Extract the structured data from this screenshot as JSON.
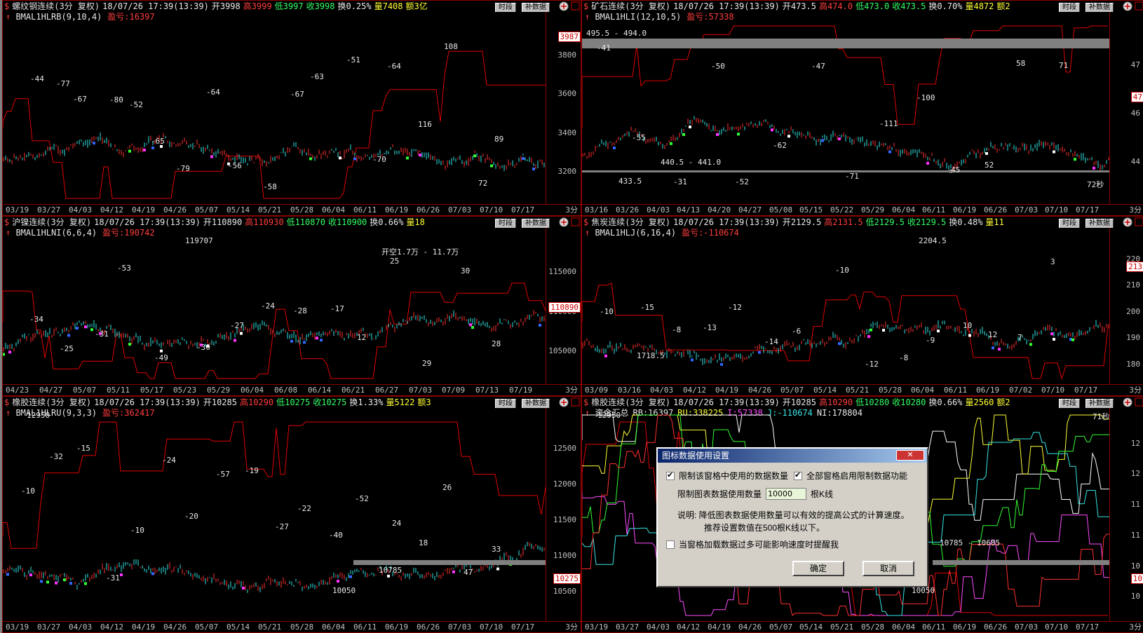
{
  "panels": [
    {
      "id": "rb",
      "title": "螺纹钢连续(3分 复权)",
      "datetime": "18/07/26 17:39(13:39)",
      "quote": {
        "open": "开3998",
        "high": "高3999",
        "low": "低3997",
        "close": "收3998",
        "turnover": "换0.25%",
        "volume": "量7408",
        "amount": "额3亿"
      },
      "btn1": "时段",
      "btn2": "补数据",
      "indicator": "BMAL1HLRB(9,10,4)",
      "pnl": "盈亏:16397",
      "y_ticks": [
        "3800",
        "3600",
        "3400",
        "3200"
      ],
      "price_tag": "3987",
      "x_ticks": [
        "03/19",
        "03/27",
        "04/03",
        "04/12",
        "04/19",
        "04/26",
        "05/07",
        "05/14",
        "05/21",
        "05/28",
        "06/04",
        "06/11",
        "06/19",
        "06/26",
        "07/03",
        "07/10",
        "07/17"
      ],
      "period": "3分",
      "notes": [
        "-44",
        "-77",
        "-67",
        "-80",
        "-52",
        "-65",
        "-79",
        "-64",
        "-56",
        "-58",
        "-67",
        "-63",
        "-51",
        "-70",
        "-64",
        "116",
        "108",
        "72",
        "89"
      ]
    },
    {
      "id": "i",
      "title": "矿石连续(3分 复权)",
      "datetime": "18/07/26 17:39(13:39)",
      "quote": {
        "open": "开473.5",
        "high": "高474.0",
        "low": "低473.0",
        "close": "收473.5",
        "turnover": "换0.70%",
        "volume": "量4872",
        "amount": "额2"
      },
      "btn1": "时段",
      "btn2": "补数据",
      "indicator": "BMAL1HLI(12,10,5)",
      "pnl": "盈亏:57338",
      "y_ticks": [
        "47",
        "46",
        "44"
      ],
      "price_tag": "47",
      "x_ticks": [
        "03/16",
        "03/26",
        "04/03",
        "04/13",
        "04/20",
        "04/27",
        "05/08",
        "05/15",
        "05/22",
        "05/29",
        "06/04",
        "06/11",
        "06/19",
        "06/26",
        "07/03",
        "07/10",
        "07/17"
      ],
      "period": "3分",
      "annot": [
        "495.5 - 494.0",
        "440.5 - 441.0",
        "433.5",
        "72秒"
      ],
      "notes": [
        "-41",
        "-55",
        "-31",
        "-50",
        "-52",
        "-62",
        "-47",
        "-71",
        "-111",
        "-100",
        "45",
        "52",
        "58",
        "71"
      ]
    },
    {
      "id": "ni",
      "title": "沪镍连续(3分 复权)",
      "datetime": "18/07/26 17:39(13:39)",
      "quote": {
        "open": "开110890",
        "high": "高110930",
        "low": "低110870",
        "close": "收110900",
        "turnover": "换0.66%",
        "volume": "量18"
      },
      "btn1": "时段",
      "btn2": "补数据",
      "indicator": "BMAL1HLNI(6,6,4)",
      "pnl": "盈亏:190742",
      "y_ticks": [
        "115000",
        "110000",
        "105000"
      ],
      "price_tag": "110890",
      "x_ticks": [
        "04/23",
        "04/27",
        "05/07",
        "05/11",
        "05/17",
        "05/23",
        "05/29",
        "06/04",
        "06/08",
        "06/14",
        "06/21",
        "06/27",
        "07/03",
        "07/09",
        "07/13",
        "07/19"
      ],
      "period": "3分",
      "annot": [
        "119707",
        "开空1.7万 - 11.7万"
      ],
      "notes": [
        "-34",
        "-25",
        "-31",
        "-53",
        "-49",
        "-30",
        "-27",
        "-24",
        "-28",
        "-17",
        "12",
        "25",
        "29",
        "30",
        "28"
      ]
    },
    {
      "id": "j",
      "title": "焦炭连续(3分 复权)",
      "datetime": "18/07/26 17:39(13:39)",
      "quote": {
        "open": "开2129.5",
        "high": "高2131.5",
        "low": "低2129.5",
        "close": "收2129.5",
        "turnover": "换0.48%",
        "volume": "量11"
      },
      "btn1": "时段",
      "btn2": "补数据",
      "indicator": "BMAL1HLJ(6,16,4)",
      "pnl": "盈亏:-110674",
      "y_ticks": [
        "220",
        "210",
        "200",
        "190",
        "180"
      ],
      "price_tag": "213",
      "x_ticks": [
        "03/09",
        "03/16",
        "04/03",
        "04/12",
        "04/19",
        "04/26",
        "05/07",
        "05/14",
        "05/21",
        "05/28",
        "06/04",
        "06/11",
        "06/19",
        "07/02",
        "07/10",
        "07/17"
      ],
      "period": "3分",
      "annot": [
        "2204.5",
        "1718.5"
      ],
      "notes": [
        "-10",
        "-15",
        "-8",
        "-13",
        "-12",
        "-14",
        "-6",
        "-10",
        "-12",
        "-8",
        "-9",
        "10",
        "12",
        "7",
        "3"
      ]
    },
    {
      "id": "ru",
      "title": "橡胶连续(3分 复权)",
      "datetime": "18/07/26 17:39(13:39)",
      "quote": {
        "open": "开10285",
        "high": "高10290",
        "low": "低10275",
        "close": "收10275",
        "turnover": "换1.33%",
        "volume": "量5122",
        "amount": "额3"
      },
      "btn1": "时段",
      "btn2": "补数据",
      "indicator": "BMAL1HLRU(9,3,3)",
      "pnl": "盈亏:362417",
      "y_ticks": [
        "12500",
        "12000",
        "11500",
        "11000",
        "10500"
      ],
      "price_tag": "10275",
      "x_ticks": [
        "03/19",
        "03/27",
        "04/03",
        "04/12",
        "04/19",
        "04/26",
        "05/07",
        "05/14",
        "05/21",
        "05/28",
        "06/04",
        "06/11",
        "06/19",
        "06/26",
        "07/03",
        "07/10",
        "07/17"
      ],
      "period": "3分",
      "annot": [
        "12950",
        "10785",
        "10050"
      ],
      "notes": [
        "-10",
        "-32",
        "-15",
        "-31",
        "-10",
        "-24",
        "-20",
        "-57",
        "-19",
        "-27",
        "-22",
        "-40",
        "-52",
        "24",
        "18",
        "26",
        "47",
        "33"
      ]
    },
    {
      "id": "sum",
      "title": "橡胶连续(3分 复权)",
      "datetime": "18/07/26 17:39(13:39)",
      "quote": {
        "open": "开10285",
        "high": "高10290",
        "low": "低10280",
        "close": "收10280",
        "turnover": "换0.66%",
        "volume": "量2560",
        "amount": "额2"
      },
      "btn1": "时段",
      "btn2": "补数据",
      "legend": {
        "label": "资金汇总",
        "rb": "RB:16397",
        "ru": "RU:338225",
        "i": "I:57338",
        "j": "J:-110674",
        "ni": "NI:178804"
      },
      "y_ticks": [
        "12",
        "12",
        "11",
        "11",
        "10",
        "10"
      ],
      "price_tag": "10",
      "x_ticks": [
        "03/19",
        "03/27",
        "04/03",
        "04/12",
        "04/19",
        "04/26",
        "05/07",
        "05/14",
        "05/21",
        "05/28",
        "06/04",
        "06/11",
        "06/19",
        "06/26",
        "07/03",
        "07/10",
        "07/17"
      ],
      "period": "3分",
      "annot": [
        "12950",
        "10785 - 10685",
        "10050",
        "71秒"
      ]
    }
  ],
  "dialog": {
    "title": "图标数据使用设置",
    "close": "✕",
    "cb1": "限制该窗格中使用的数据数量",
    "cb2": "全部窗格启用限制数据功能",
    "count_label": "限制图表数据使用数量",
    "count_value": "10000",
    "count_unit": "根K线",
    "note1": "说明: 降低图表数据使用数量可以有效的提高公式的计算速度。",
    "note2": "推荐设置数值在500根K线以下。",
    "cb3": "当窗格加载数据过多可能影响速度时提醒我",
    "ok": "确定",
    "cancel": "取消"
  }
}
